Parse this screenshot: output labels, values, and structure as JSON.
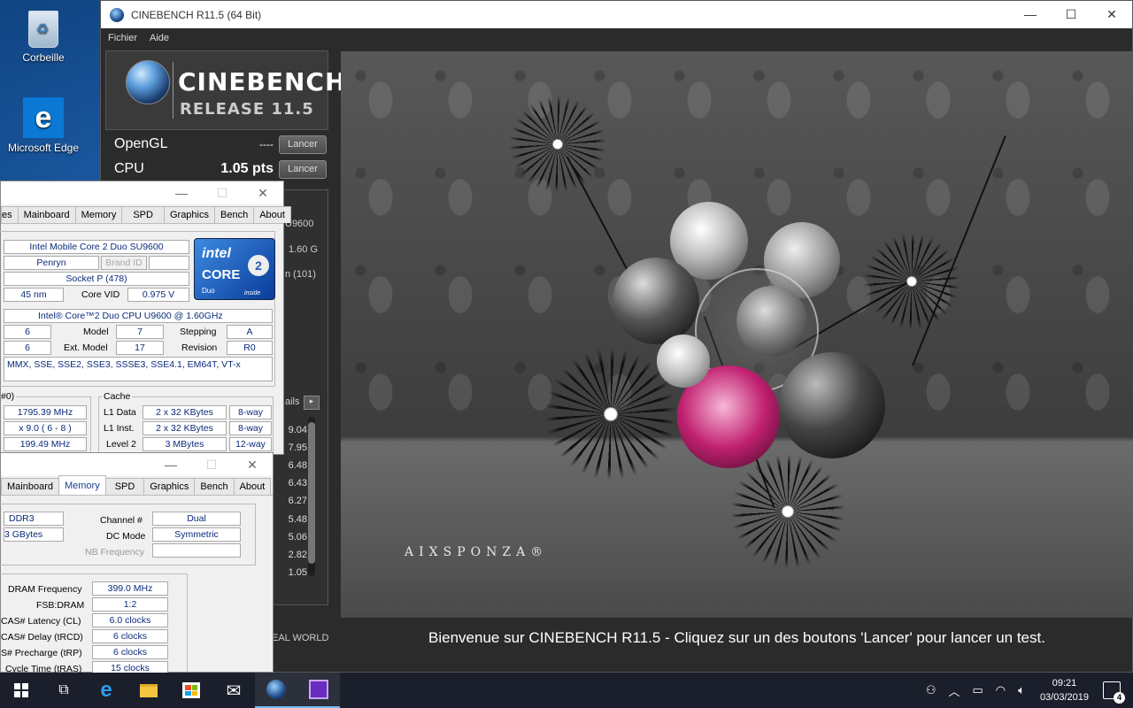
{
  "desktop": {
    "icons": [
      {
        "label": "Corbeille"
      },
      {
        "label": "Microsoft Edge"
      }
    ]
  },
  "cinebench": {
    "title": "CINEBENCH R11.5 (64 Bit)",
    "menu": [
      "Fichier",
      "Aide"
    ],
    "brand": "CINEBENCH",
    "release": "RELEASE 11.5",
    "opengl": {
      "label": "OpenGL",
      "value": "----",
      "button": "Lancer"
    },
    "cpu": {
      "label": "CPU",
      "value": "1.05 pts",
      "button": "Lancer"
    },
    "side_partial": [
      "U9600",
      "1.60 G",
      "n (101)",
      "ails"
    ],
    "ranking_values": [
      "9.04",
      "7.95",
      "6.48",
      "6.43",
      "6.27",
      "5.48",
      "5.06",
      "2.82",
      "1.05"
    ],
    "real_world": "EAL WORLD",
    "render_brand": "AIXSPONZA®",
    "caption": "Bienvenue sur CINEBENCH R11.5 - Cliquez sur un des boutons 'Lancer' pour lancer un test."
  },
  "cpuz_cpu": {
    "tabs": [
      "es",
      "Mainboard",
      "Memory",
      "SPD",
      "Graphics",
      "Bench",
      "About"
    ],
    "name": "Intel Mobile Core 2 Duo SU9600",
    "codename": "Penryn",
    "brand_id_label": "Brand ID",
    "package": "Socket P (478)",
    "technology": "45 nm",
    "core_vid_label": "Core VID",
    "core_vid": "0.975 V",
    "specification": "Intel® Core™2 Duo CPU      U9600  @ 1.60GHz",
    "family": "6",
    "model_label": "Model",
    "model": "7",
    "stepping_label": "Stepping",
    "stepping": "A",
    "ext_family": "6",
    "ext_model_label": "Ext. Model",
    "ext_model": "17",
    "revision_label": "Revision",
    "revision": "R0",
    "instructions": "MMX, SSE, SSE2, SSE3, SSSE3, SSE4.1, EM64T, VT-x",
    "clocks_label": "#0)",
    "core_speed": "1795.39 MHz",
    "multiplier": "x 9.0 ( 6 - 8 )",
    "bus_speed": "199.49 MHz",
    "cache_label": "Cache",
    "l1d_label": "L1 Data",
    "l1d": "2 x 32 KBytes",
    "l1d_way": "8-way",
    "l1i_label": "L1 Inst.",
    "l1i": "2 x 32 KBytes",
    "l1i_way": "8-way",
    "l2_label": "Level 2",
    "l2": "3 MBytes",
    "l2_way": "12-way",
    "badge": {
      "intel": "intel",
      "core": "CORE",
      "two": "2",
      "duo": "Duo",
      "inside": "inside"
    }
  },
  "cpuz_mem": {
    "tabs": [
      "Mainboard",
      "Memory",
      "SPD",
      "Graphics",
      "Bench",
      "About"
    ],
    "type": "DDR3",
    "size": "3 GBytes",
    "channel_label": "Channel #",
    "channel": "Dual",
    "dc_mode_label": "DC Mode",
    "dc_mode": "Symmetric",
    "nb_freq_label": "NB Frequency",
    "dram_freq_label": "DRAM Frequency",
    "dram_freq": "399.0 MHz",
    "fsb_dram_label": "FSB:DRAM",
    "fsb_dram": "1:2",
    "cl_label": "CAS# Latency (CL)",
    "cl": "6.0 clocks",
    "trcd_label": "CAS# Delay (tRCD)",
    "trcd": "6 clocks",
    "trp_label": "S# Precharge (tRP)",
    "trp": "6 clocks",
    "tras_label": "Cycle Time (tRAS)",
    "tras": "15 clocks"
  },
  "taskbar": {
    "time": "09:21",
    "date": "03/03/2019",
    "notifications": "4"
  }
}
